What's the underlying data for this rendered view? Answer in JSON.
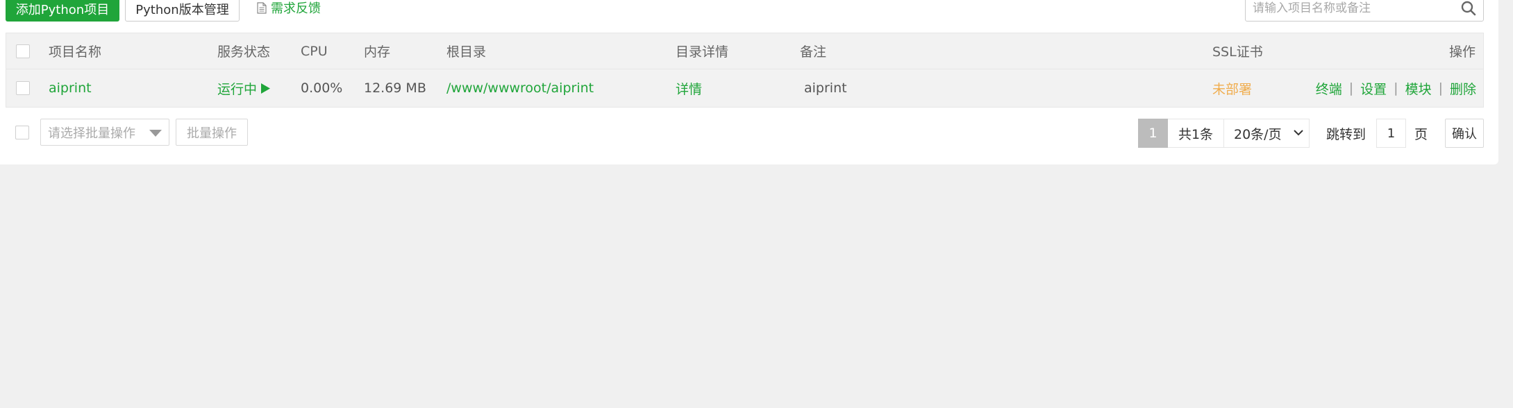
{
  "toolbar": {
    "add_button": "添加Python项目",
    "version_button": "Python版本管理",
    "feedback_link": "需求反馈",
    "search_placeholder": "请输入项目名称或备注"
  },
  "table": {
    "headers": {
      "name": "项目名称",
      "status": "服务状态",
      "cpu": "CPU",
      "memory": "内存",
      "root": "根目录",
      "dir_detail": "目录详情",
      "remark": "备注",
      "ssl": "SSL证书",
      "actions": "操作"
    },
    "rows": [
      {
        "name": "aiprint",
        "status": "运行中",
        "cpu": "0.00%",
        "memory": "12.69 MB",
        "root": "/www/wwwroot/aiprint",
        "dir_detail": "详情",
        "remark": "aiprint",
        "ssl": "未部署",
        "actions": {
          "terminal": "终端",
          "settings": "设置",
          "modules": "模块",
          "delete": "删除"
        }
      }
    ]
  },
  "batch": {
    "select_placeholder": "请选择批量操作",
    "button": "批量操作"
  },
  "pagination": {
    "current_page": "1",
    "total": "共1条",
    "page_size": "20条/页",
    "jump_label": "跳转到",
    "jump_value": "1",
    "page_unit": "页",
    "confirm": "确认"
  },
  "colors": {
    "accent": "#20a53a",
    "warning": "#f0ad4e"
  }
}
